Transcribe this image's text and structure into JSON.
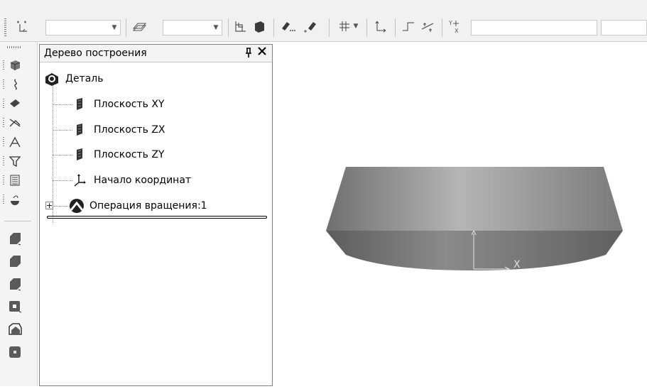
{
  "toolbar": {
    "combo1_value": "",
    "combo2_value": "",
    "coord_field_value": "",
    "coord_field2_value": ""
  },
  "tree": {
    "title": "Дерево построения",
    "root_label": "Деталь",
    "items": [
      {
        "label": "Плоскость XY",
        "icon": "plane-icon"
      },
      {
        "label": "Плоскость ZX",
        "icon": "plane-icon"
      },
      {
        "label": "Плоскость ZY",
        "icon": "plane-icon"
      },
      {
        "label": "Начало координат",
        "icon": "origin-axes-icon"
      },
      {
        "label": "Операция вращения:1",
        "icon": "revolve-operation-icon"
      }
    ]
  },
  "viewport": {
    "axis_label_x": "X"
  },
  "colors": {
    "body_top": "#8c8c8c",
    "body_side": "#6e6e6e"
  }
}
